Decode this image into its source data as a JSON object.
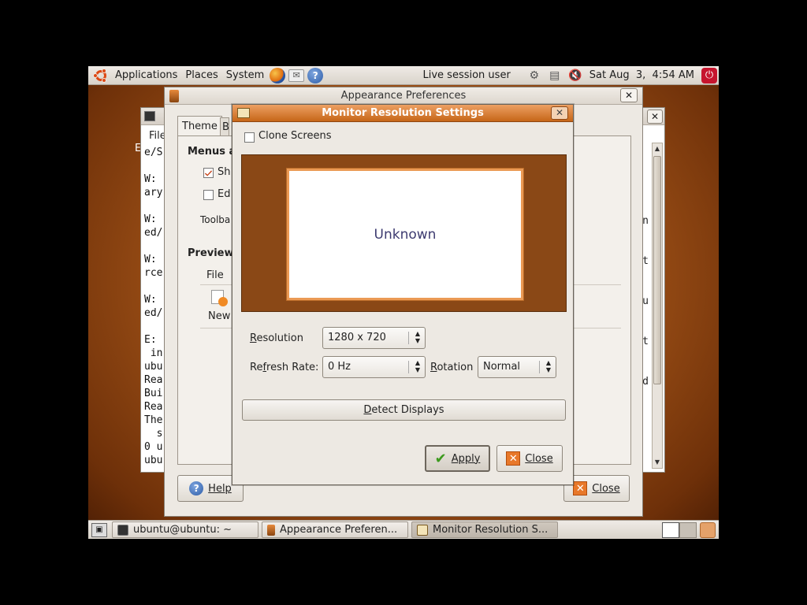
{
  "top_panel": {
    "menus": [
      "Applications",
      "Places",
      "System"
    ],
    "user": "Live session user",
    "clock": "Sat Aug  3,  4:54 AM"
  },
  "terminal": {
    "menu_fragment": "File",
    "lines": [
      "e/S",
      "",
      "W:",
      "ary",
      "",
      "W:",
      "ed/",
      "",
      "W:",
      "rce",
      "",
      "W:",
      "ed/",
      "",
      "E:",
      " in",
      "ubu",
      "Rea",
      "Bui",
      "Rea",
      "The",
      "  s",
      "0 u",
      "ubu"
    ],
    "right_fragments": [
      "n",
      "t",
      "u",
      "t",
      "d"
    ],
    "left_fragments": [
      "E"
    ]
  },
  "appearance": {
    "title": "Appearance Preferences",
    "tab_theme": "Theme",
    "tab_background_fragment": "B",
    "menus_heading": "Menus a",
    "show_fragment": "Sh",
    "edit_fragment": "Ed",
    "toolbar_fragment": "Toolba",
    "preview_heading": "Preview",
    "preview_file": "File",
    "preview_new": "New",
    "help_button": "Help",
    "close_button": "Close"
  },
  "monitor": {
    "title": "Monitor Resolution Settings",
    "clone_screens": "Clone Screens",
    "clone_checked": false,
    "screen_label": "Unknown",
    "resolution_label": "Resolution",
    "resolution_value": "1280 x 720",
    "refresh_label": "Refresh Rate:",
    "refresh_value": "0 Hz",
    "rotation_label": "Rotation",
    "rotation_value": "Normal",
    "detect_button": "Detect Displays",
    "apply_button": "Apply",
    "close_button": "Close"
  },
  "taskbar": {
    "items": [
      {
        "label": "ubuntu@ubuntu: ~",
        "active": false
      },
      {
        "label": "Appearance Preferen...",
        "active": false
      },
      {
        "label": "Monitor Resolution S...",
        "active": true
      }
    ]
  },
  "colors": {
    "ubuntu_orange": "#dd4814",
    "dialog_titlebar": "#d97c2e",
    "screen_preview_bg": "#8a4816"
  }
}
